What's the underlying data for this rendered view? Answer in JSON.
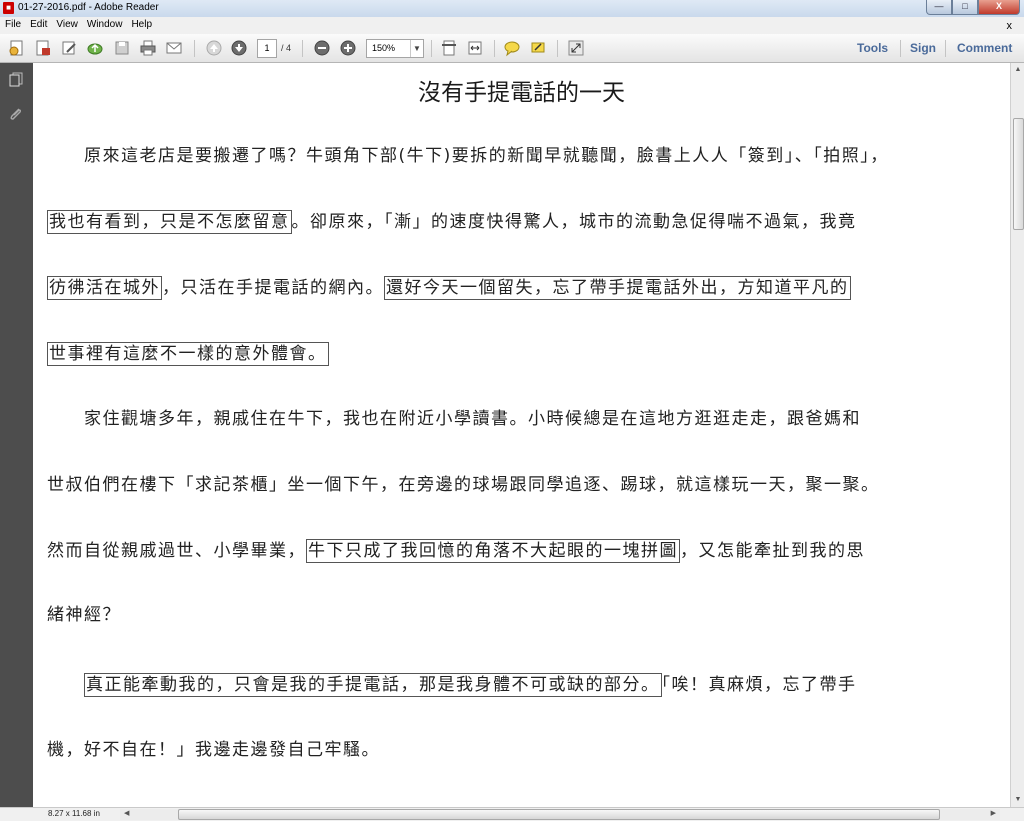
{
  "window": {
    "title": "01-27-2016.pdf - Adobe Reader",
    "minimize": "—",
    "maximize": "□",
    "close": "X"
  },
  "menu": {
    "items": [
      "File",
      "Edit",
      "View",
      "Window",
      "Help"
    ],
    "close_doc": "x"
  },
  "toolbar": {
    "page_current": "1",
    "page_total": "/ 4",
    "zoom_value": "150%",
    "tools_label": "Tools",
    "sign_label": "Sign",
    "comment_label": "Comment"
  },
  "document": {
    "title": "沒有手提電話的一天",
    "lines": [
      {
        "segments": [
          {
            "text": "　　原來這老店是要搬遷了嗎？牛頭角下部(牛下)要拆的新聞早就聽聞，臉書上人人「簽到」、「拍照」，",
            "boxed": false
          }
        ]
      },
      {
        "segments": [
          {
            "text": "我也有看到，只是不怎麼留意",
            "boxed": true
          },
          {
            "text": "。卻原來，「漸」的速度快得驚人，城市的流動急促得喘不過氣，我竟",
            "boxed": false
          }
        ]
      },
      {
        "segments": [
          {
            "text": "彷彿活在城外",
            "boxed": true
          },
          {
            "text": "，只活在手提電話的網內。",
            "boxed": false
          },
          {
            "text": "還好今天一個留失，忘了帶手提電話外出，方知道平凡的",
            "boxed": true
          }
        ]
      },
      {
        "segments": [
          {
            "text": "世事裡有這麼不一樣的意外體會。",
            "boxed": true
          }
        ]
      },
      {
        "segments": [
          {
            "text": "　　家住觀塘多年，親戚住在牛下，我也在附近小學讀書。小時候總是在這地方逛逛走走，跟爸媽和",
            "boxed": false
          }
        ]
      },
      {
        "segments": [
          {
            "text": "世叔伯們在樓下「求記茶櫃」坐一個下午，在旁邊的球場跟同學追逐、踢球，就這樣玩一天，聚一聚。",
            "boxed": false
          }
        ]
      },
      {
        "segments": [
          {
            "text": "然而自從親戚過世、小學畢業，",
            "boxed": false
          },
          {
            "text": "牛下只成了我回憶的角落不大起眼的一塊拼圖",
            "boxed": true
          },
          {
            "text": "，又怎能牽扯到我的思",
            "boxed": false
          }
        ]
      },
      {
        "segments": [
          {
            "text": "緒神經？",
            "boxed": false
          }
        ]
      },
      {
        "segments": [
          {
            "text": "　　",
            "boxed": false
          },
          {
            "text": "真正能牽動我的，只會是我的手提電話，那是我身體不可或缺的部分。",
            "boxed": true
          },
          {
            "text": "「唉！真麻煩，忘了帶手",
            "boxed": false
          }
        ]
      },
      {
        "segments": [
          {
            "text": "機，好不自在！」我邊走邊發自己牢騷。",
            "boxed": false
          }
        ]
      }
    ]
  },
  "status": {
    "page_size": "8.27 x 11.68 in"
  }
}
